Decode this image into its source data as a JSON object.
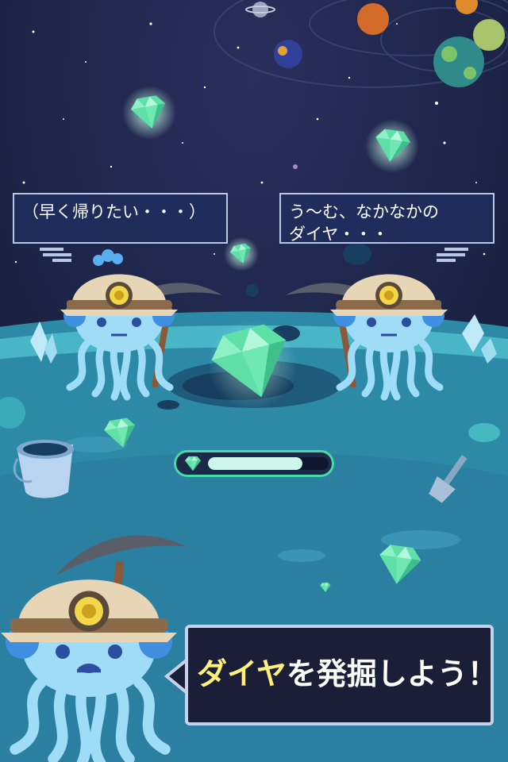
{
  "dialogs": {
    "left": {
      "lines": [
        "（早く帰りたい・・・）"
      ]
    },
    "right": {
      "lines": [
        "う〜む、なかなかの",
        "ダイヤ・・・"
      ]
    }
  },
  "mining": {
    "progress": 0.78
  },
  "callout": {
    "highlight": "ダイヤ",
    "rest": "を発掘しよう！"
  },
  "colors": {
    "space": "#1a2142",
    "planet": "#2d8aa6",
    "jellyfish": "#9fdcf8",
    "gem": "#5ee0a6",
    "helmet": "#e6d6b6",
    "highlight": "#fff07a"
  },
  "icons": [
    "diamond-icon",
    "pickaxe-icon",
    "bucket-icon",
    "shovel-icon",
    "planet-icon",
    "miner-lamp-icon"
  ]
}
